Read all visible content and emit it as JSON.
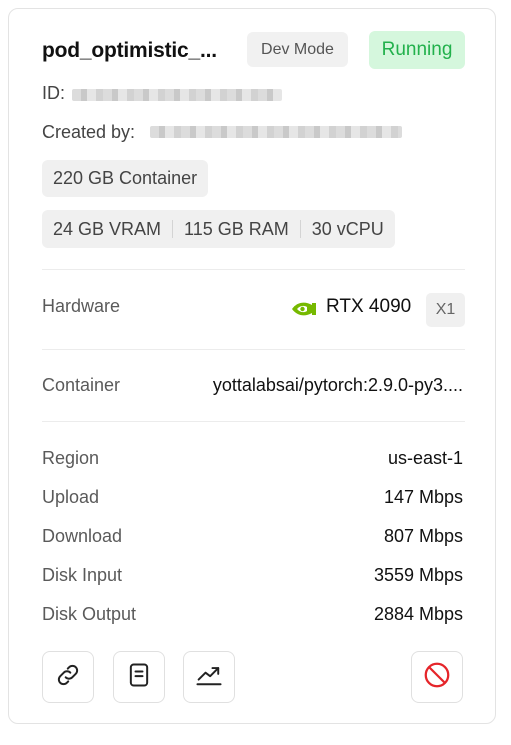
{
  "pod": {
    "name": "pod_optimistic_...",
    "dev_mode_label": "Dev Mode",
    "status": "Running",
    "id_label": "ID:",
    "created_by_label": "Created by:",
    "container_size": "220 GB Container",
    "specs": [
      "24 GB VRAM",
      "115 GB RAM",
      "30 vCPU"
    ]
  },
  "details": {
    "hardware_label": "Hardware",
    "hardware_value": "RTX 4090",
    "hardware_count": "X1",
    "container_label": "Container",
    "container_value": "yottalabsai/pytorch:2.9.0-py3...."
  },
  "stats": [
    {
      "label": "Region",
      "value": "us-east-1"
    },
    {
      "label": "Upload",
      "value": "147 Mbps"
    },
    {
      "label": "Download",
      "value": "807 Mbps"
    },
    {
      "label": "Disk Input",
      "value": "3559 Mbps"
    },
    {
      "label": "Disk Output",
      "value": "2884 Mbps"
    }
  ],
  "actions": {
    "icons": [
      "link-icon",
      "logs-icon",
      "chart-icon",
      "stop-icon"
    ]
  },
  "colors": {
    "running_bg": "#d5f7dd",
    "running_text": "#22b14c",
    "nvidia_green": "#76b900",
    "danger": "#e5252a"
  }
}
